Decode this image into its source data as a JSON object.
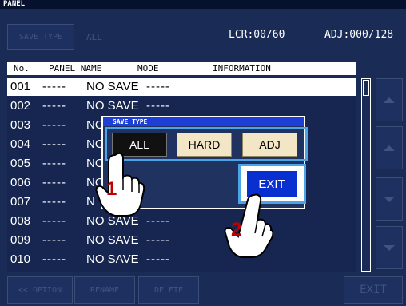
{
  "window": {
    "title": "PANEL"
  },
  "toolbar": {
    "save_type_label": "SAVE TYPE",
    "save_type_value": "ALL",
    "lcr_counter": "LCR:00/60",
    "adj_counter": "ADJ:000/128"
  },
  "table": {
    "headers": [
      "No.",
      "PANEL NAME",
      "MODE",
      "INFORMATION"
    ],
    "rows": [
      {
        "no": "001",
        "dash1": "-----",
        "name": "NO SAVE",
        "dash2": "-----"
      },
      {
        "no": "002",
        "dash1": "-----",
        "name": "NO SAVE",
        "dash2": "-----"
      },
      {
        "no": "003",
        "dash1": "-----",
        "name": "NO",
        "dash2": ""
      },
      {
        "no": "004",
        "dash1": "-----",
        "name": "NO",
        "dash2": ""
      },
      {
        "no": "005",
        "dash1": "-----",
        "name": "NO",
        "dash2": ""
      },
      {
        "no": "006",
        "dash1": "-----",
        "name": "NO",
        "dash2": ""
      },
      {
        "no": "007",
        "dash1": "-----",
        "name": "N",
        "dash2": ""
      },
      {
        "no": "008",
        "dash1": "-----",
        "name": "NO SAVE",
        "dash2": "-----"
      },
      {
        "no": "009",
        "dash1": "-----",
        "name": "NO SAVE",
        "dash2": "-----"
      },
      {
        "no": "010",
        "dash1": "-----",
        "name": "NO SAVE",
        "dash2": "-----"
      }
    ],
    "selected_index": 0
  },
  "footer": {
    "option_label": "<< OPTION",
    "rename_label": "RENAME",
    "delete_label": "DELETE",
    "exit_label": "EXIT"
  },
  "dialog": {
    "title": "SAVE TYPE",
    "options": [
      "ALL",
      "HARD",
      "ADJ"
    ],
    "selected_option": "ALL",
    "exit_label": "EXIT"
  },
  "annotations": {
    "step1": "1",
    "step2": "2"
  },
  "colors": {
    "background": "#1a2c56",
    "dialog_title_bar": "#1d3fd8",
    "highlight_outline": "#4aa4e6",
    "exit_button": "#0a2fd0",
    "option_button": "#f2e6c6"
  }
}
